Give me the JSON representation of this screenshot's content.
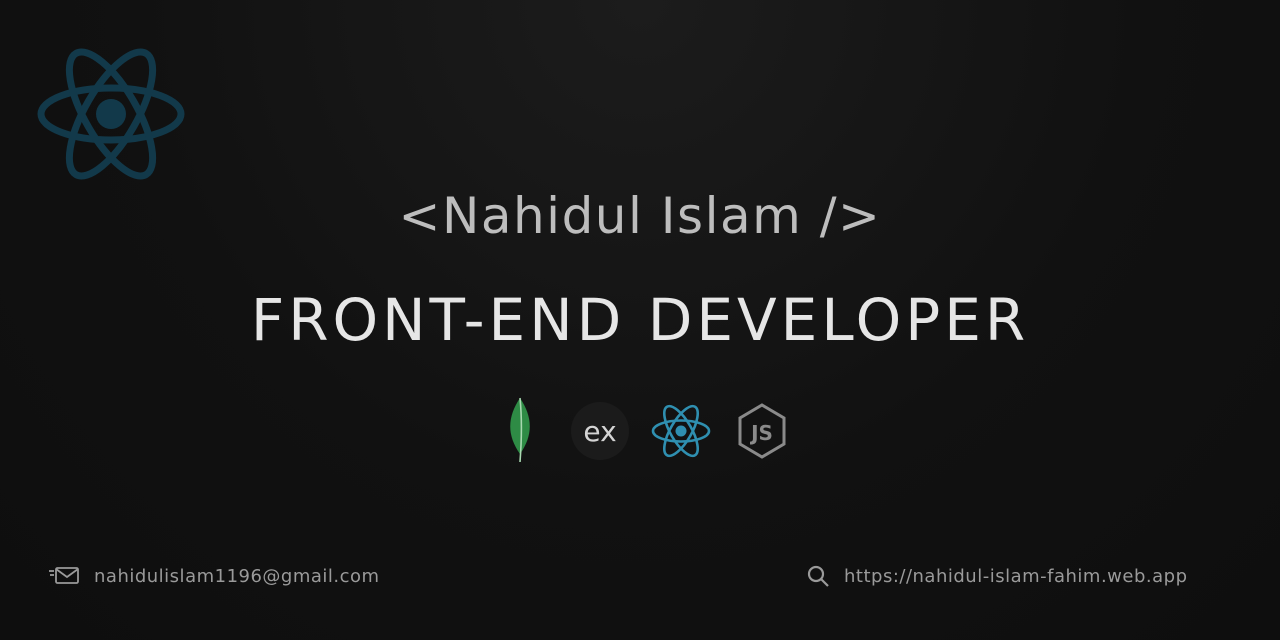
{
  "header": {
    "name": "<Nahidul Islam />",
    "role": "FRONT-END DEVELOPER"
  },
  "tech_stack": {
    "icons": [
      "react-logo-icon",
      "mongodb-leaf-icon",
      "express-icon",
      "react-icon",
      "nodejs-icon"
    ],
    "express_label": "ex",
    "nodejs_label": "JS"
  },
  "contact": {
    "email": "nahidulislam1196@gmail.com",
    "website": "https://nahidul-islam-fahim.web.app"
  },
  "colors": {
    "background": "#121212",
    "react_large": "#12394a",
    "react_small": "#2f8fb0",
    "mongodb": "#2e8b45",
    "text_primary": "#e6e6e6",
    "text_muted": "#9a9a9a"
  }
}
